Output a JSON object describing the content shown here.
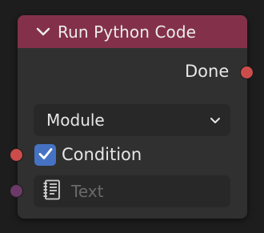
{
  "node": {
    "title": "Run Python Code",
    "header_color": "#83314a",
    "output_done_label": "Done",
    "mode_dropdown": {
      "selected": "Module"
    },
    "condition": {
      "label": "Condition",
      "checked": true
    },
    "text_input": {
      "placeholder": "Text"
    }
  },
  "colors": {
    "canvas": "#1d1d1d",
    "node_body": "#303030",
    "field_bg": "#282828",
    "socket_boolean": "#cc4c4c",
    "socket_text": "#6b3a68",
    "checkbox_accent": "#4672c4"
  },
  "icons": {
    "collapse": "chevron-down-icon",
    "dropdown": "chevron-down-icon",
    "checkbox": "checkmark-icon",
    "text_field": "text-block-icon"
  }
}
